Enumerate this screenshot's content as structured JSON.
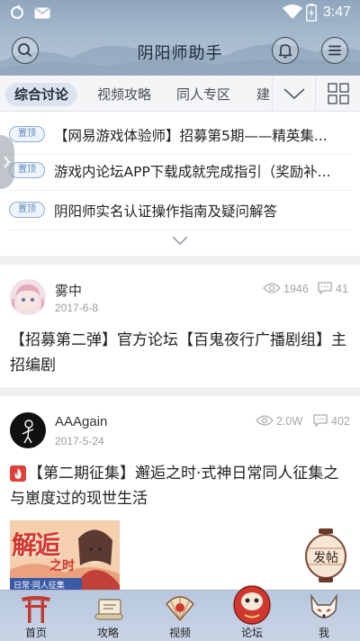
{
  "status_bar": {
    "time": "3:47"
  },
  "header": {
    "title": "阴阳师助手"
  },
  "tabs": [
    {
      "label": "综合讨论",
      "active": true
    },
    {
      "label": "视频攻略",
      "active": false
    },
    {
      "label": "同人专区",
      "active": false
    },
    {
      "label": "建",
      "active": false
    }
  ],
  "pinned": {
    "tag": "置顶",
    "items": [
      "【网易游戏体验师】招募第5期——精英集...",
      "游戏内论坛APP下载成就完成指引（奖励补...",
      "阴阳师实名认证操作指南及疑问解答"
    ]
  },
  "posts": [
    {
      "username": "雾中",
      "date": "2017-6-8",
      "views": "1946",
      "comments": "41",
      "title": "【招募第二弹】官方论坛【百鬼夜行广播剧组】主招编剧"
    },
    {
      "username": "AAAgain",
      "date": "2017-5-24",
      "views": "2.0W",
      "comments": "402",
      "title": "【第二期征集】邂逅之时·式神日常同人征集之与崽度过的现世生活",
      "banner_text": "解逅",
      "banner_sub": "之时",
      "banner_caption": "日常·同人征集"
    }
  ],
  "fab": {
    "label": "发帖"
  },
  "bottom_nav": [
    {
      "label": "首页",
      "icon": "torii-icon"
    },
    {
      "label": "攻略",
      "icon": "scroll-icon"
    },
    {
      "label": "视频",
      "icon": "fan-icon"
    },
    {
      "label": "论坛",
      "icon": "daruma-icon",
      "active": true
    },
    {
      "label": "我",
      "icon": "fox-mask-icon"
    }
  ],
  "colors": {
    "accent": "#5c88b8",
    "header": "#a9bccf",
    "nav": "#c9d5e6"
  }
}
